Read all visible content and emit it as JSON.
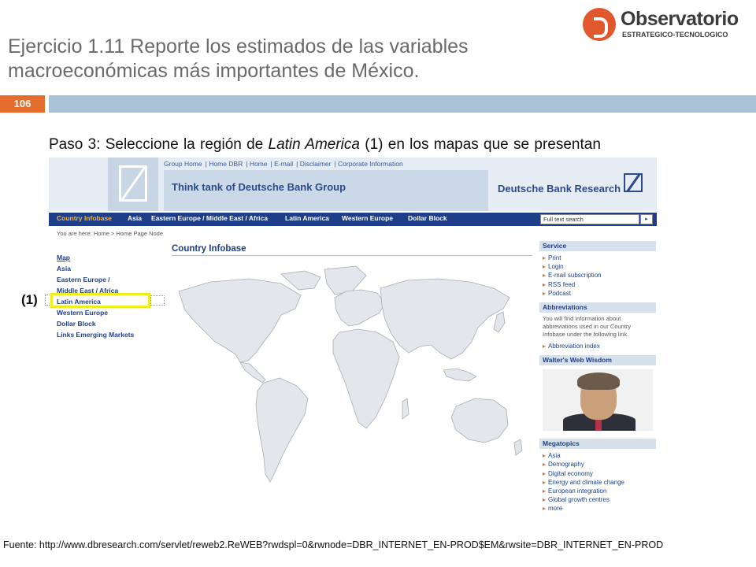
{
  "slide": {
    "title": "Ejercicio 1.11 Reporte los estimados de las variables macroeconómicas más importantes de México.",
    "page_number": "106",
    "step_prefix": "Paso 3: Seleccione la región de ",
    "step_emph": "Latin America",
    "step_suffix": " (1) en los mapas que se presentan",
    "callout": "(1)",
    "source": "Fuente: http://www.dbresearch.com/servlet/reweb2.ReWEB?rwdspl=0&rwnode=DBR_INTERNET_EN-PROD$EM&rwsite=DBR_INTERNET_EN-PROD"
  },
  "logo": {
    "name": "Observatorio",
    "sub": "ESTRATEGICO-TECNOLOGICO"
  },
  "site": {
    "top_links": [
      "Group Home",
      "Home DBR",
      "Home",
      "E-mail",
      "Disclaimer",
      "Corporate Information"
    ],
    "tagline": "Think tank of Deutsche Bank Group",
    "brand": "Deutsche Bank Research",
    "nav": [
      "Country Infobase",
      "Asia",
      "Eastern Europe / Middle East / Africa",
      "Latin America",
      "Western Europe",
      "Dollar Block"
    ],
    "search_placeholder": "Full text search",
    "search_button": "▸",
    "breadcrumb": "You are here:  Home > Home Page Node",
    "left_nav": [
      "Map",
      "Asia",
      "Eastern Europe /",
      "Middle East / Africa",
      "Latin America",
      "Western Europe",
      "Dollar Block",
      "Links Emerging Markets"
    ],
    "section_title": "Country Infobase",
    "sidebar": {
      "service": {
        "header": "Service",
        "items": [
          "Print",
          "Login",
          "E-mail subscription",
          "RSS feed",
          "Podcast"
        ]
      },
      "abbreviations": {
        "header": "Abbreviations",
        "text": "You will find information about abbreviations used in our Country Infobase under the following link.",
        "link": "Abbreviation index"
      },
      "wisdom": {
        "header": "Walter's Web Wisdom"
      },
      "megatopics": {
        "header": "Megatopics",
        "items": [
          "Asia",
          "Demography",
          "Digital economy",
          "Energy and climate change",
          "European integration",
          "Global growth centres",
          "more"
        ]
      }
    }
  },
  "colors": {
    "accent_orange": "#e46c2c",
    "nav_blue": "#1e3f88",
    "highlight_yellow": "#f1ee1e",
    "map_land": "#e3e6ea"
  }
}
